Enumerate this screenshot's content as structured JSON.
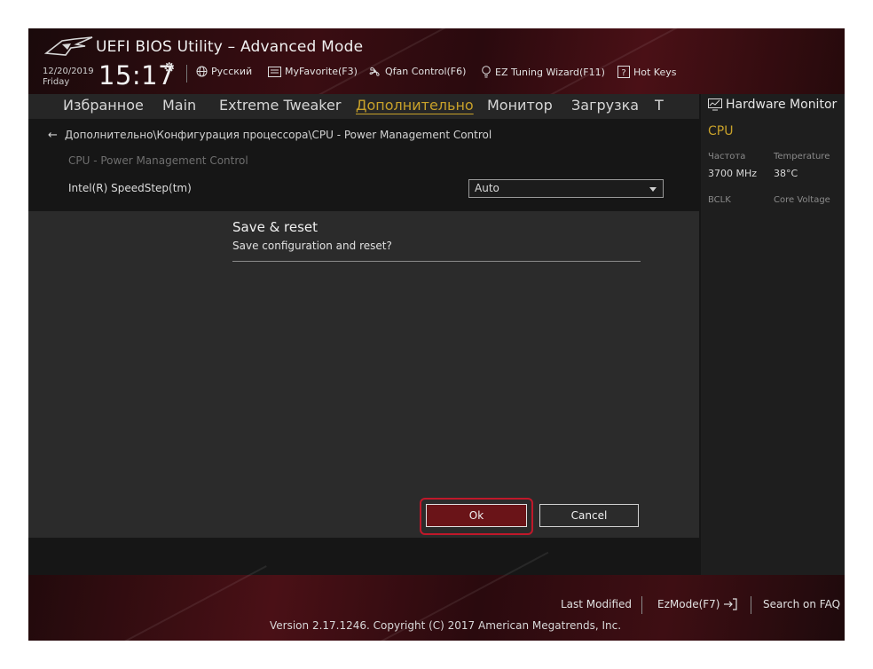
{
  "header": {
    "title": "UEFI BIOS Utility – Advanced Mode",
    "date": "12/20/2019",
    "day": "Friday",
    "time": "15:17",
    "toolbar": {
      "language": "Русский",
      "myfavorite": "MyFavorite(F3)",
      "qfan": "Qfan Control(F6)",
      "ez_tuning": "EZ Tuning Wizard(F11)",
      "hotkeys": "Hot Keys"
    }
  },
  "menu": {
    "items": [
      "Избранное",
      "Main",
      "Extreme Tweaker",
      "Дополнительно",
      "Монитор",
      "Загрузка",
      "Т"
    ],
    "active": "Дополнительно"
  },
  "main": {
    "breadcrumb": "Дополнительно\\Конфигурация процессора\\CPU - Power Management Control",
    "section_title": "CPU - Power Management Control",
    "setting_label": "Intel(R) SpeedStep(tm)",
    "setting_value": "Auto"
  },
  "hardware_monitor": {
    "title": "Hardware Monitor",
    "cpu_label": "CPU",
    "freq_label": "Частота",
    "temp_label": "Temperature",
    "freq_value": "3700 MHz",
    "temp_value": "38°C",
    "bclk_label": "BCLK",
    "voltage_label": "Core Voltage"
  },
  "dialog": {
    "title": "Save & reset",
    "message": "Save configuration and reset?",
    "ok_label": "Ok",
    "cancel_label": "Cancel"
  },
  "footer": {
    "last_modified": "Last Modified",
    "ezmode": "EzMode(F7)",
    "search_faq": "Search on FAQ",
    "version": "Version 2.17.1246. Copyright (C) 2017 American Megatrends, Inc."
  },
  "colors": {
    "accent_gold": "#c8a12a",
    "highlight_red": "#c0182a",
    "ok_button_bg": "#6a1418"
  }
}
